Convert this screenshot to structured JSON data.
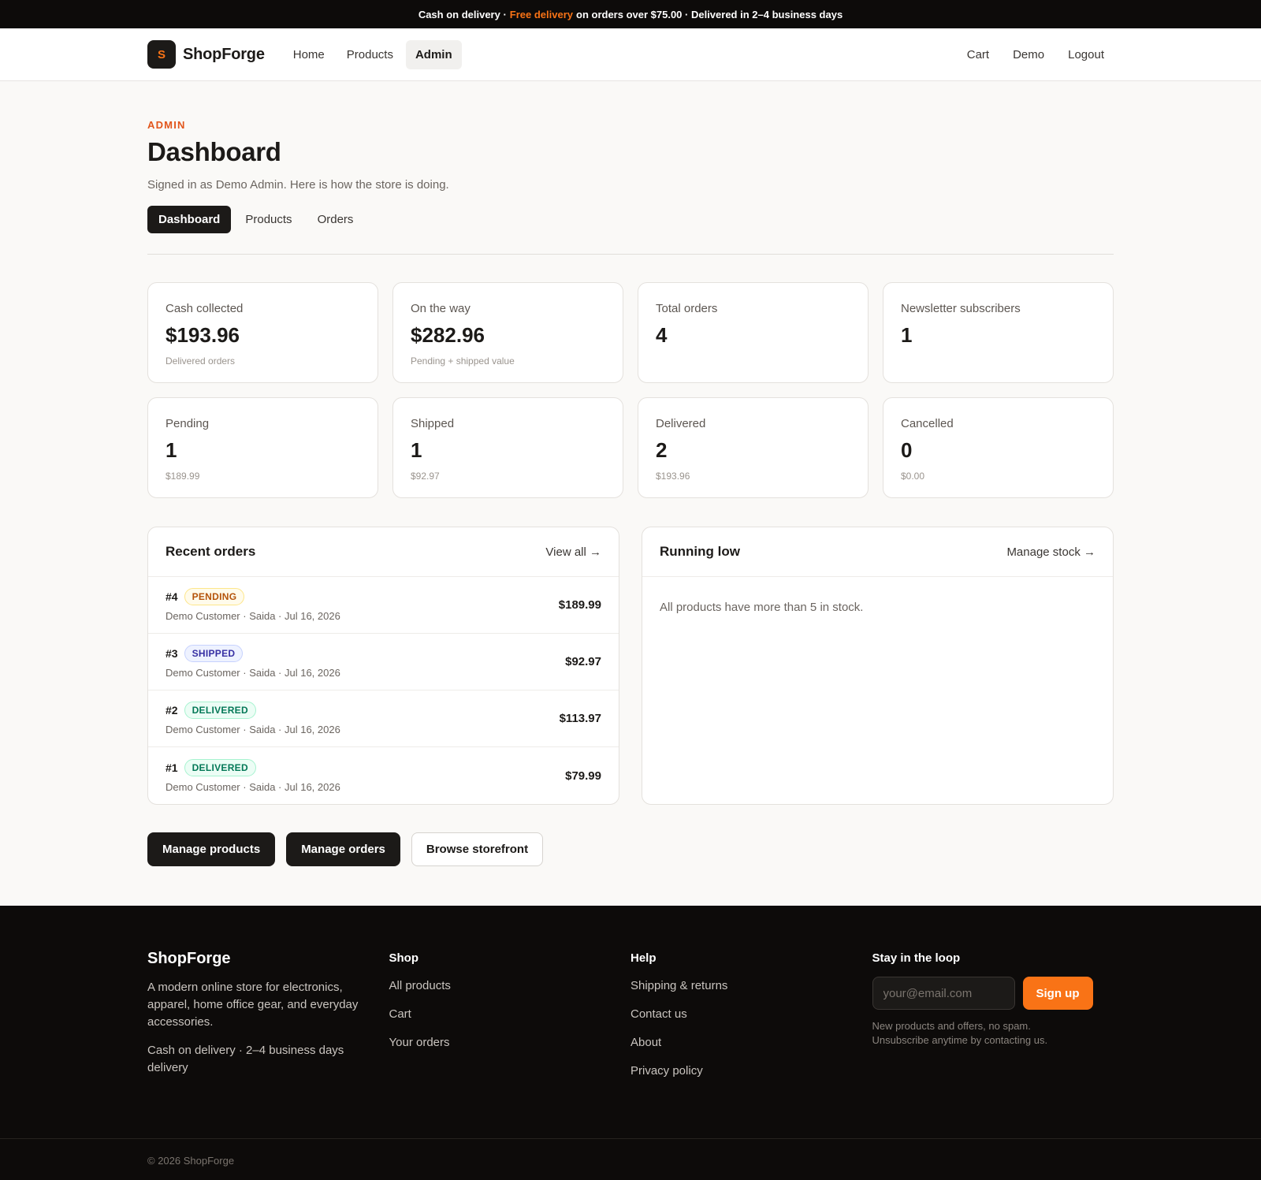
{
  "announcement": {
    "prefix": "Cash on delivery ·",
    "highlight": "Free delivery",
    "suffix": "on orders over $75.00 · Delivered in 2–4 business days"
  },
  "nav": {
    "logo_letter": "S",
    "brand": "ShopForge",
    "links": [
      {
        "label": "Home"
      },
      {
        "label": "Products"
      },
      {
        "label": "Admin",
        "active": true
      }
    ],
    "right": [
      {
        "label": "Cart"
      },
      {
        "label": "Demo"
      },
      {
        "label": "Logout"
      }
    ]
  },
  "header": {
    "eyebrow": "ADMIN",
    "title": "Dashboard",
    "subtitle": "Signed in as Demo Admin. Here is how the store is doing."
  },
  "tabs": [
    {
      "label": "Dashboard",
      "active": true
    },
    {
      "label": "Products"
    },
    {
      "label": "Orders"
    }
  ],
  "stats": [
    {
      "label": "Cash collected",
      "value": "$193.96",
      "note": "Delivered orders"
    },
    {
      "label": "On the way",
      "value": "$282.96",
      "note": "Pending + shipped value"
    },
    {
      "label": "Total orders",
      "value": "4",
      "note": ""
    },
    {
      "label": "Newsletter subscribers",
      "value": "1",
      "note": ""
    },
    {
      "label": "Pending",
      "value": "1",
      "note": "$189.99"
    },
    {
      "label": "Shipped",
      "value": "1",
      "note": "$92.97"
    },
    {
      "label": "Delivered",
      "value": "2",
      "note": "$193.96"
    },
    {
      "label": "Cancelled",
      "value": "0",
      "note": "$0.00"
    }
  ],
  "recent_orders": {
    "title": "Recent orders",
    "link": "View all →",
    "orders": [
      {
        "id": "#4",
        "status": "PENDING",
        "status_key": "pending",
        "meta": "Demo Customer · Saida · Jul 16, 2026",
        "total": "$189.99"
      },
      {
        "id": "#3",
        "status": "SHIPPED",
        "status_key": "shipped",
        "meta": "Demo Customer · Saida · Jul 16, 2026",
        "total": "$92.97"
      },
      {
        "id": "#2",
        "status": "DELIVERED",
        "status_key": "delivered",
        "meta": "Demo Customer · Saida · Jul 16, 2026",
        "total": "$113.97"
      },
      {
        "id": "#1",
        "status": "DELIVERED",
        "status_key": "delivered",
        "meta": "Demo Customer · Saida · Jul 16, 2026",
        "total": "$79.99"
      }
    ]
  },
  "running_low": {
    "title": "Running low",
    "link": "Manage stock →",
    "empty": "All products have more than 5 in stock."
  },
  "actions": {
    "manage_products": "Manage products",
    "manage_orders": "Manage orders",
    "browse": "Browse storefront"
  },
  "footer": {
    "brand": "ShopForge",
    "desc": "A modern online store for electronics, apparel, home office gear, and everyday accessories.",
    "delivery": "Cash on delivery · 2–4 business days delivery",
    "shop": {
      "heading": "Shop",
      "links": [
        "All products",
        "Cart",
        "Your orders"
      ]
    },
    "help": {
      "heading": "Help",
      "links": [
        "Shipping & returns",
        "Contact us",
        "About",
        "Privacy policy"
      ]
    },
    "newsletter": {
      "heading": "Stay in the loop",
      "placeholder": "your@email.com",
      "button": "Sign up",
      "note": "New products and offers, no spam. Unsubscribe anytime by contacting us."
    },
    "copyright": "© 2026 ShopForge"
  },
  "colors": {
    "accent": "#f97316",
    "dark": "#1c1a18",
    "eyebrow": "#e2561c"
  }
}
